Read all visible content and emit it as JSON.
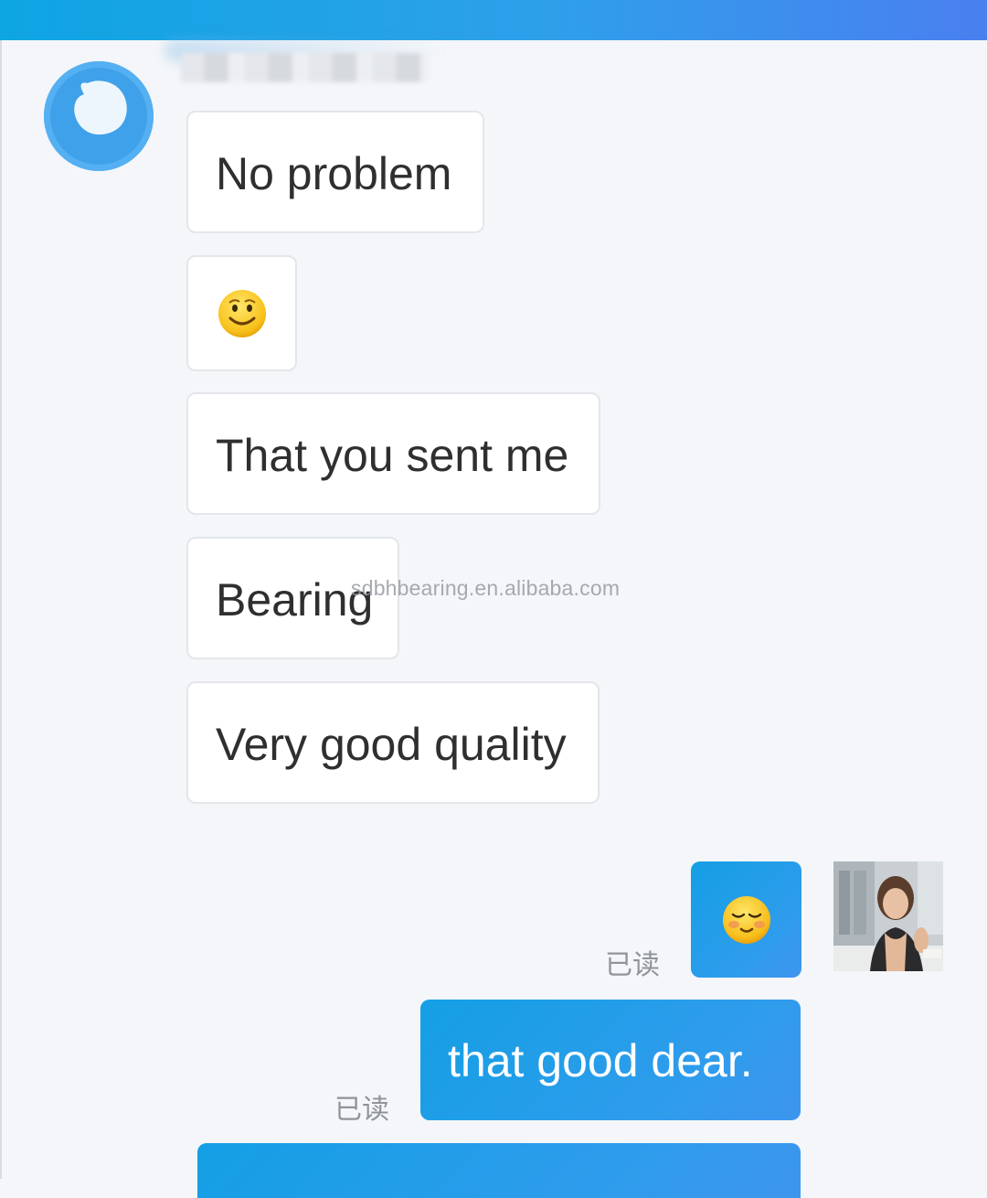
{
  "header": {
    "bar_colors": [
      "#0ea5e3",
      "#4a7ff0"
    ]
  },
  "contact": {
    "avatar_icon": "chat-bubble-icon"
  },
  "messages_incoming": [
    {
      "text": "No problem"
    },
    {
      "emoji": "🙂",
      "icon": "smiling-face-icon"
    },
    {
      "text": "That you sent me"
    },
    {
      "text": "Bearing"
    },
    {
      "text": "Very good quality"
    }
  ],
  "messages_outgoing": [
    {
      "emoji": "😌",
      "icon": "relieved-face-icon",
      "status": "已读"
    },
    {
      "text": "that good dear.",
      "status": "已读"
    }
  ],
  "watermark": "sdbhbearing.en.alibaba.com",
  "colors": {
    "incoming_bubble": "#ffffff",
    "outgoing_bubble": "#1fa0e8",
    "background": "#f4f6f9",
    "read_status": "#8f949a"
  }
}
